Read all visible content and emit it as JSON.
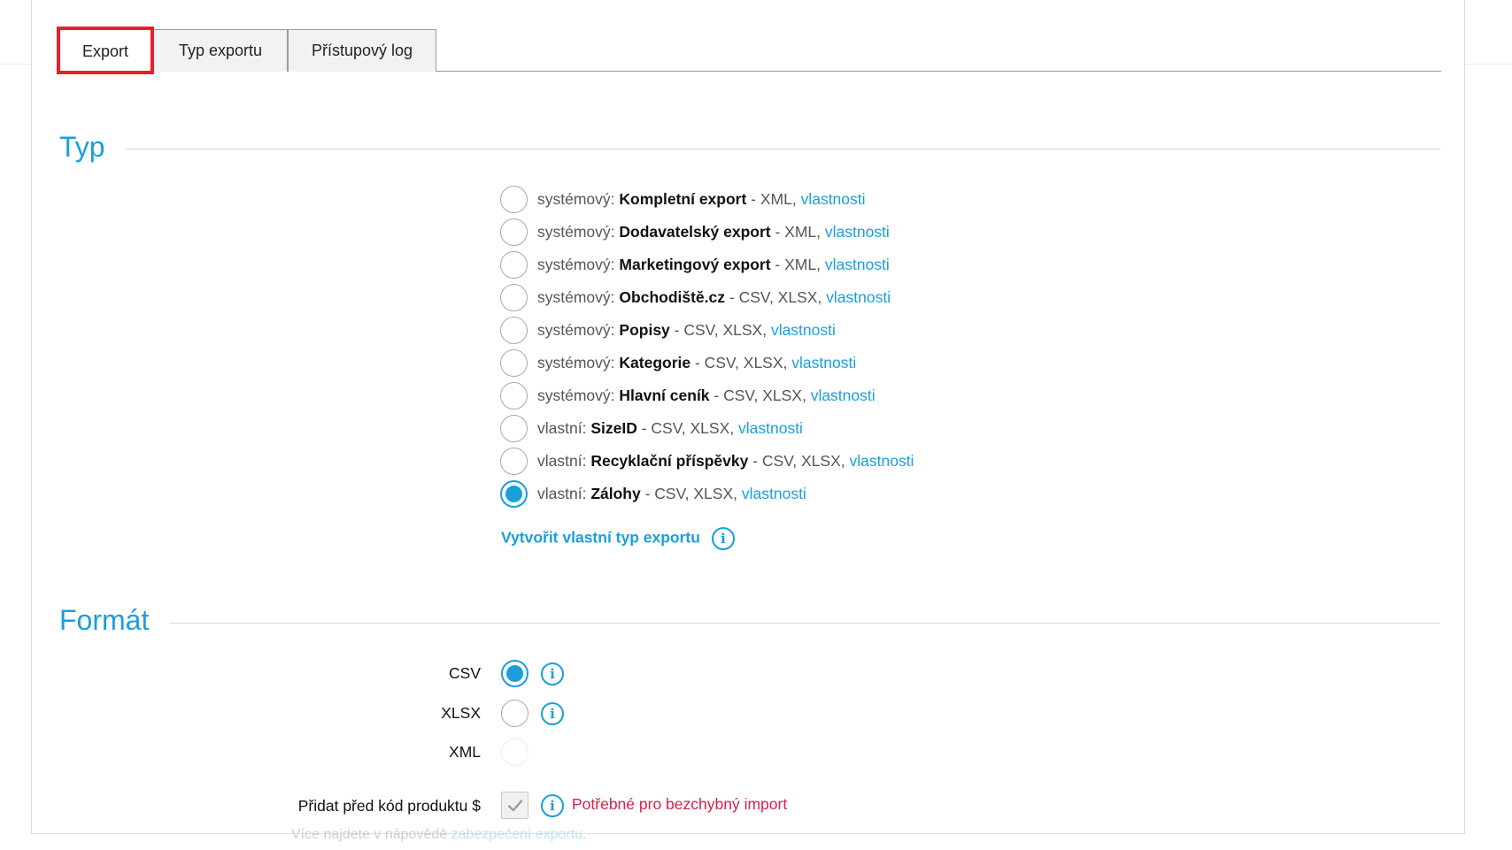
{
  "tabs": [
    {
      "label": "Export",
      "active": true
    },
    {
      "label": "Typ exportu",
      "active": false
    },
    {
      "label": "Přístupový log",
      "active": false
    }
  ],
  "sections": {
    "type_title": "Typ",
    "format_title": "Formát"
  },
  "export_types": [
    {
      "prefix": "systémový:",
      "name": "Kompletní export",
      "formats": " - XML, ",
      "link": "vlastnosti",
      "checked": false
    },
    {
      "prefix": "systémový:",
      "name": "Dodavatelský export",
      "formats": " - XML, ",
      "link": "vlastnosti",
      "checked": false
    },
    {
      "prefix": "systémový:",
      "name": "Marketingový export",
      "formats": " - XML, ",
      "link": "vlastnosti",
      "checked": false
    },
    {
      "prefix": "systémový:",
      "name": "Obchodiště.cz",
      "formats": " - CSV, XLSX, ",
      "link": "vlastnosti",
      "checked": false
    },
    {
      "prefix": "systémový:",
      "name": "Popisy",
      "formats": " - CSV, XLSX, ",
      "link": "vlastnosti",
      "checked": false
    },
    {
      "prefix": "systémový:",
      "name": "Kategorie",
      "formats": " - CSV, XLSX, ",
      "link": "vlastnosti",
      "checked": false
    },
    {
      "prefix": "systémový:",
      "name": "Hlavní ceník",
      "formats": " - CSV, XLSX, ",
      "link": "vlastnosti",
      "checked": false
    },
    {
      "prefix": "vlastní:",
      "name": "SizeID",
      "formats": " - CSV, XLSX, ",
      "link": "vlastnosti",
      "checked": false
    },
    {
      "prefix": "vlastní:",
      "name": "Recyklační příspěvky",
      "formats": " - CSV, XLSX, ",
      "link": "vlastnosti",
      "checked": false
    },
    {
      "prefix": "vlastní:",
      "name": "Zálohy",
      "formats": " - CSV, XLSX, ",
      "link": "vlastnosti",
      "checked": true
    }
  ],
  "create_link": "Vytvořit vlastní typ exportu",
  "formats": {
    "csv": {
      "label": "CSV",
      "checked": true
    },
    "xlsx": {
      "label": "XLSX",
      "checked": false
    },
    "xml": {
      "label": "XML",
      "checked": false,
      "disabled": true
    }
  },
  "prefix_option": {
    "label": "Přidat před kód produktu $",
    "checked": true,
    "warning": "Potřebné pro bezchybný import"
  },
  "footer_note": {
    "text": "Více najdete v nápovědě ",
    "link": "zabezpečení exportu",
    "suffix": "."
  },
  "colors": {
    "accent": "#1a9fdb",
    "highlight": "#e8202a",
    "warning": "#d6204a"
  },
  "icons": {
    "info": "info-icon",
    "check": "check-icon"
  }
}
